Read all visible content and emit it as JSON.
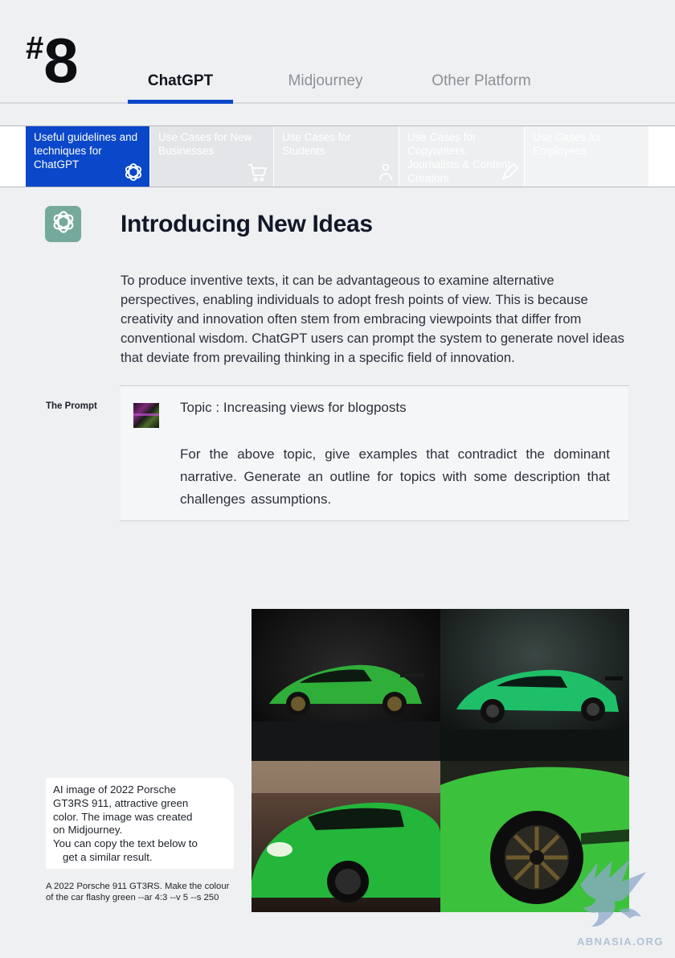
{
  "header": {
    "hash": "#",
    "number": "8",
    "tabs": [
      {
        "label": "ChatGPT",
        "active": true
      },
      {
        "label": "Midjourney",
        "active": false
      },
      {
        "label": "Other Platform",
        "active": false
      }
    ]
  },
  "subnav": {
    "cards": [
      {
        "label": "Useful guidelines and techniques for ChatGPT",
        "icon": "openai-logo-icon",
        "active": true
      },
      {
        "label": "Use Cases for New Businesses",
        "icon": "cart-icon",
        "active": false
      },
      {
        "label": "Use Cases for Students",
        "icon": "student-icon",
        "active": false
      },
      {
        "label": "Use Cases for Copywriters, Journalists & Content Creators",
        "icon": "pen-icon",
        "active": false
      },
      {
        "label": "Use Cases for Employees",
        "icon": "employee-icon",
        "active": false
      }
    ]
  },
  "section": {
    "title": "Introducing New Ideas",
    "body": "To produce inventive texts, it can be advantageous to examine alternative perspectives, enabling individuals to adopt fresh points of view. This is because creativity and innovation often stem from embracing viewpoints that differ from conventional wisdom. ChatGPT users can prompt the system to generate novel ideas that deviate from prevailing thinking in a specific field of innovation."
  },
  "prompt": {
    "label": "The Prompt",
    "topic": "Topic : Increasing views for blogposts",
    "body": "For the above topic, give examples that contradict the dominant narrative. Generate an outline for topics with some description that challenges assumptions."
  },
  "caption": {
    "lines": [
      "AI image of 2022 Porsche",
      "GT3RS 911, attractive green",
      "color. The image was created",
      "on Midjourney.",
      "You can copy the text below to"
    ],
    "indent_line": "get a similar result.",
    "prompt_text": "A 2022 Porsche 911 GT3RS. Make the colour of the car flashy green --ar 4:3 --v 5 --s 250"
  },
  "image_tiles": [
    {
      "name": "green-porsche-studio-left",
      "bg": "#0f0f10",
      "car": "#2fae3a"
    },
    {
      "name": "green-porsche-studio-right",
      "bg": "#1a2321",
      "car": "#1fbf6a"
    },
    {
      "name": "green-porsche-garage-front",
      "bg": "#3a2c25",
      "car": "#23b63a"
    },
    {
      "name": "green-porsche-wheel-closeup",
      "bg": "#1f231c",
      "car": "#3cc13c"
    }
  ],
  "watermark": {
    "text": "ABNASIA.ORG",
    "color": "#b3c2d3"
  },
  "colors": {
    "accent": "#0a47c9",
    "page_bg": "#eff0f2",
    "logo_tile": "#75a99c"
  }
}
